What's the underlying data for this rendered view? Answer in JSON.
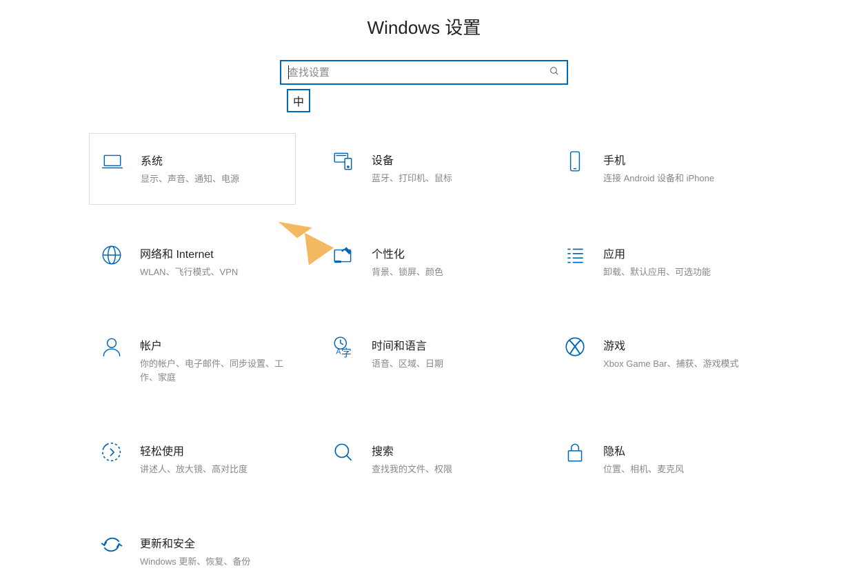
{
  "header": {
    "title": "Windows 设置"
  },
  "search": {
    "placeholder": "查找设置"
  },
  "ime": {
    "indicator": "中"
  },
  "cards": {
    "system": {
      "title": "系统",
      "subtitle": "显示、声音、通知、电源"
    },
    "devices": {
      "title": "设备",
      "subtitle": "蓝牙、打印机、鼠标"
    },
    "phone": {
      "title": "手机",
      "subtitle": "连接 Android 设备和 iPhone"
    },
    "network": {
      "title": "网络和 Internet",
      "subtitle": "WLAN、飞行模式、VPN"
    },
    "personalization": {
      "title": "个性化",
      "subtitle": "背景、锁屏、颜色"
    },
    "apps": {
      "title": "应用",
      "subtitle": "卸载、默认应用、可选功能"
    },
    "accounts": {
      "title": "帐户",
      "subtitle": "你的帐户、电子邮件、同步设置、工作、家庭"
    },
    "time": {
      "title": "时间和语言",
      "subtitle": "语音、区域、日期"
    },
    "gaming": {
      "title": "游戏",
      "subtitle": "Xbox Game Bar、捕获、游戏模式"
    },
    "ease": {
      "title": "轻松使用",
      "subtitle": "讲述人、放大镜、高对比度"
    },
    "searchcat": {
      "title": "搜索",
      "subtitle": "查找我的文件、权限"
    },
    "privacy": {
      "title": "隐私",
      "subtitle": "位置、相机、麦克风"
    },
    "update": {
      "title": "更新和安全",
      "subtitle": "Windows 更新、恢复、备份"
    }
  },
  "colors": {
    "accent": "#0067b8",
    "arrow": "#f4b860"
  }
}
